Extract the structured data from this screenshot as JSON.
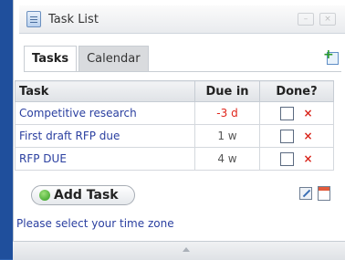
{
  "window": {
    "title": "Task List"
  },
  "tabs": [
    {
      "label": "Tasks",
      "active": true
    },
    {
      "label": "Calendar",
      "active": false
    }
  ],
  "table": {
    "headers": {
      "task": "Task",
      "due": "Due in",
      "done": "Done?"
    },
    "rows": [
      {
        "task": "Competitive research",
        "due": "-3 d",
        "overdue": true,
        "done": false,
        "delete": "×"
      },
      {
        "task": "First draft RFP due",
        "due": "1 w",
        "overdue": false,
        "done": false,
        "delete": "×"
      },
      {
        "task": "RFP DUE",
        "due": "4 w",
        "overdue": false,
        "done": false,
        "delete": "×"
      }
    ]
  },
  "actions": {
    "add_task_label": "Add Task"
  },
  "footer": {
    "timezone_link": "Please select your time zone"
  },
  "colors": {
    "overdue": "#e0251b",
    "link": "#2a3fa0",
    "delete": "#d9261c",
    "background": "#2f62b0"
  },
  "icons": [
    "task-list-icon",
    "add-calendar-icon",
    "add-icon",
    "edit-icon",
    "calendar-icon",
    "delete-icon"
  ]
}
